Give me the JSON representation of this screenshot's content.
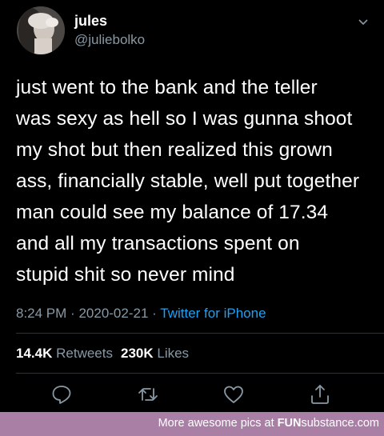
{
  "tweet": {
    "display_name": "jules",
    "handle": "@juliebolko",
    "text": "just went to the bank and the teller\nwas sexy as hell so I was gunna shoot\nmy shot but then realized this grown\nass, financially stable, well put together\nman could see my balance of 17.34\nand all my transactions spent on\nstupid shit so never mind",
    "time": "8:24 PM",
    "date": "2020-02-21",
    "separator": "·",
    "client": "Twitter for iPhone",
    "retweets_count": "14.4K",
    "retweets_label": "Retweets",
    "likes_count": "230K",
    "likes_label": "Likes"
  },
  "icons": {
    "avatar": "profile-photo",
    "menu": "chevron-down-icon",
    "reply": "reply-icon",
    "retweet": "retweet-icon",
    "like": "heart-icon",
    "share": "share-icon"
  },
  "footer": {
    "prefix": "More awesome pics at ",
    "brand_bold": "FUN",
    "brand_rest": "substance",
    "brand_suffix": ".com"
  },
  "colors": {
    "background": "#000000",
    "text": "#ffffff",
    "secondary": "#8899a6",
    "link": "#1da1f2",
    "divider": "#2f3336",
    "footer_bg": "#a97fa5"
  }
}
